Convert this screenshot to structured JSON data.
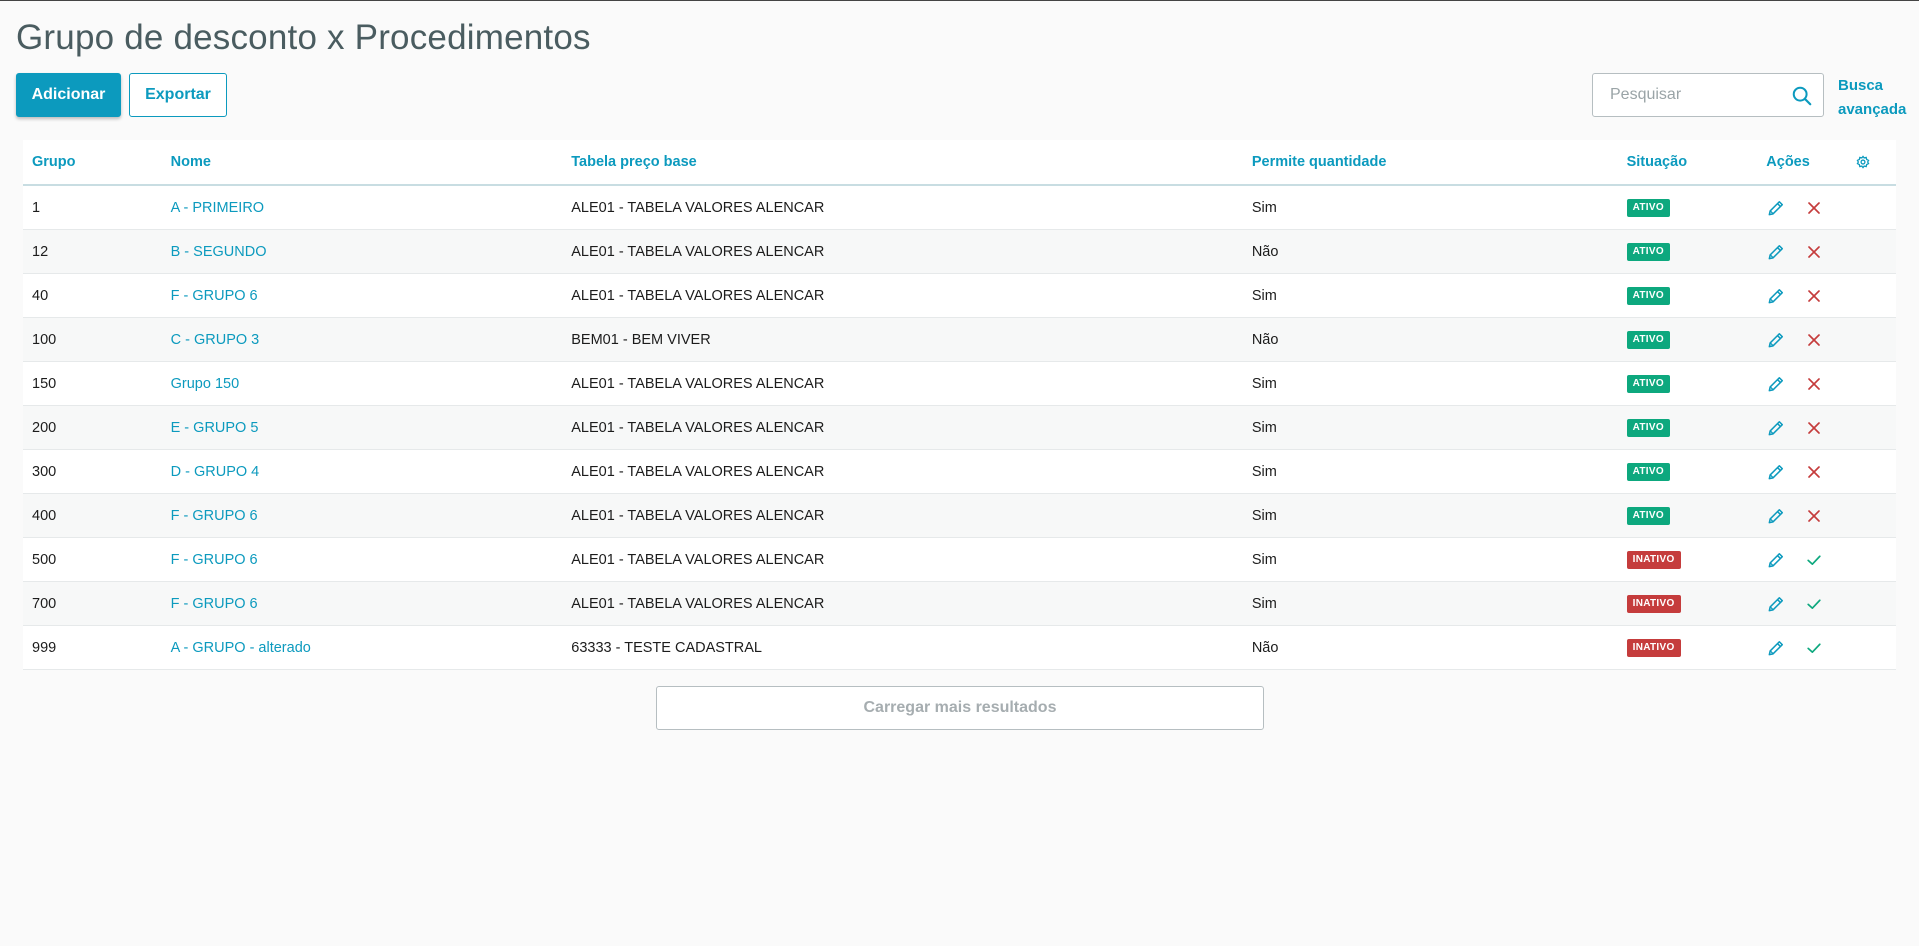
{
  "page": {
    "title": "Grupo de desconto x Procedimentos"
  },
  "toolbar": {
    "add_label": "Adicionar",
    "export_label": "Exportar",
    "search_placeholder": "Pesquisar",
    "advanced_search_line1": "Busca",
    "advanced_search_line2": "avançada"
  },
  "table": {
    "headers": {
      "grupo": "Grupo",
      "nome": "Nome",
      "tabela": "Tabela preço base",
      "permite": "Permite quantidade",
      "situacao": "Situação",
      "acoes": "Ações"
    },
    "rows": [
      {
        "grupo": "1",
        "nome": "A - PRIMEIRO",
        "tabela": "ALE01 - TABELA VALORES ALENCAR",
        "permite": "Sim",
        "situacao": "ATIVO",
        "status": "active"
      },
      {
        "grupo": "12",
        "nome": "B - SEGUNDO",
        "tabela": "ALE01 - TABELA VALORES ALENCAR",
        "permite": "Não",
        "situacao": "ATIVO",
        "status": "active"
      },
      {
        "grupo": "40",
        "nome": "F - GRUPO 6",
        "tabela": "ALE01 - TABELA VALORES ALENCAR",
        "permite": "Sim",
        "situacao": "ATIVO",
        "status": "active"
      },
      {
        "grupo": "100",
        "nome": "C - GRUPO 3",
        "tabela": "BEM01 - BEM VIVER",
        "permite": "Não",
        "situacao": "ATIVO",
        "status": "active"
      },
      {
        "grupo": "150",
        "nome": "Grupo 150",
        "tabela": "ALE01 - TABELA VALORES ALENCAR",
        "permite": "Sim",
        "situacao": "ATIVO",
        "status": "active"
      },
      {
        "grupo": "200",
        "nome": "E - GRUPO 5",
        "tabela": "ALE01 - TABELA VALORES ALENCAR",
        "permite": "Sim",
        "situacao": "ATIVO",
        "status": "active"
      },
      {
        "grupo": "300",
        "nome": "D - GRUPO 4",
        "tabela": "ALE01 - TABELA VALORES ALENCAR",
        "permite": "Sim",
        "situacao": "ATIVO",
        "status": "active"
      },
      {
        "grupo": "400",
        "nome": "F - GRUPO 6",
        "tabela": "ALE01 - TABELA VALORES ALENCAR",
        "permite": "Sim",
        "situacao": "ATIVO",
        "status": "active"
      },
      {
        "grupo": "500",
        "nome": "F - GRUPO 6",
        "tabela": "ALE01 - TABELA VALORES ALENCAR",
        "permite": "Sim",
        "situacao": "INATIVO",
        "status": "inactive"
      },
      {
        "grupo": "700",
        "nome": "F - GRUPO 6",
        "tabela": "ALE01 - TABELA VALORES ALENCAR",
        "permite": "Sim",
        "situacao": "INATIVO",
        "status": "inactive"
      },
      {
        "grupo": "999",
        "nome": "A - GRUPO - alterado",
        "tabela": "63333 - TESTE CADASTRAL",
        "permite": "Não",
        "situacao": "INATIVO",
        "status": "inactive"
      }
    ]
  },
  "footer": {
    "load_more_label": "Carregar mais resultados"
  },
  "icons": {
    "edit": "pencil-icon",
    "deactivate": "close-icon",
    "activate": "check-icon",
    "settings": "gear-icon",
    "search": "search-icon"
  },
  "colors": {
    "primary": "#0c9abe",
    "active_badge": "#0da87e",
    "inactive_badge": "#c53c3c",
    "close_icon": "#c53c3c",
    "check_icon": "#0da87e"
  }
}
